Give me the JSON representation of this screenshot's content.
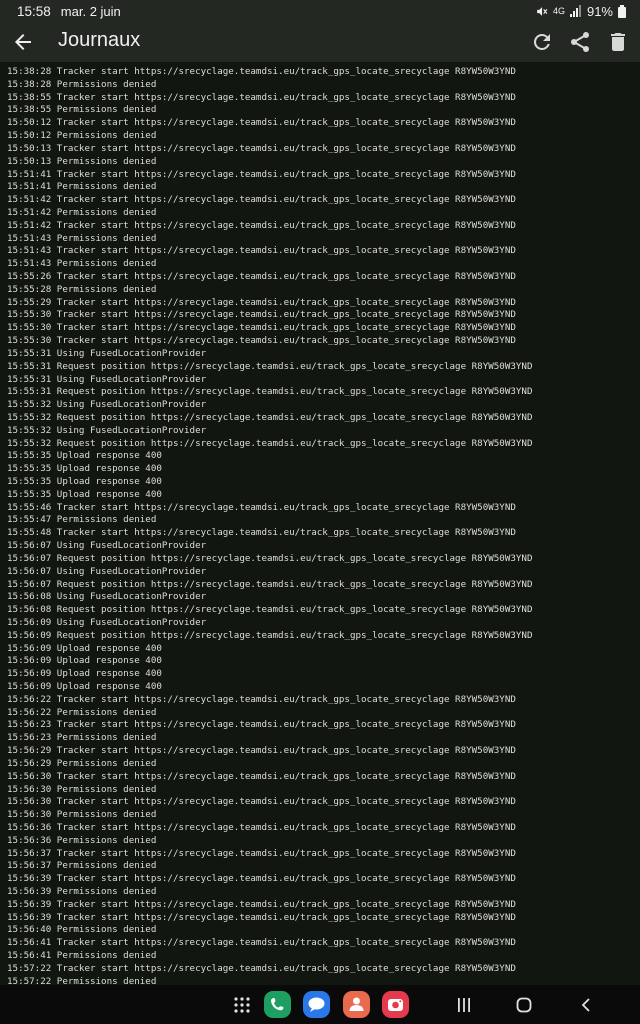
{
  "status_bar": {
    "time": "15:58",
    "date": "mar. 2 juin",
    "network": "4G",
    "battery": "91%"
  },
  "app_bar": {
    "title": "Journaux"
  },
  "log_lines": [
    "15:38:28 Tracker start https://srecyclage.teamdsi.eu/track_gps_locate_srecyclage R8YW50W3YND",
    "15:38:28 Permissions denied",
    "15:38:55 Tracker start https://srecyclage.teamdsi.eu/track_gps_locate_srecyclage R8YW50W3YND",
    "15:38:55 Permissions denied",
    "15:50:12 Tracker start https://srecyclage.teamdsi.eu/track_gps_locate_srecyclage R8YW50W3YND",
    "15:50:12 Permissions denied",
    "15:50:13 Tracker start https://srecyclage.teamdsi.eu/track_gps_locate_srecyclage R8YW50W3YND",
    "15:50:13 Permissions denied",
    "15:51:41 Tracker start https://srecyclage.teamdsi.eu/track_gps_locate_srecyclage R8YW50W3YND",
    "15:51:41 Permissions denied",
    "15:51:42 Tracker start https://srecyclage.teamdsi.eu/track_gps_locate_srecyclage R8YW50W3YND",
    "15:51:42 Permissions denied",
    "15:51:42 Tracker start https://srecyclage.teamdsi.eu/track_gps_locate_srecyclage R8YW50W3YND",
    "15:51:43 Permissions denied",
    "15:51:43 Tracker start https://srecyclage.teamdsi.eu/track_gps_locate_srecyclage R8YW50W3YND",
    "15:51:43 Permissions denied",
    "15:55:26 Tracker start https://srecyclage.teamdsi.eu/track_gps_locate_srecyclage R8YW50W3YND",
    "15:55:28 Permissions denied",
    "15:55:29 Tracker start https://srecyclage.teamdsi.eu/track_gps_locate_srecyclage R8YW50W3YND",
    "15:55:30 Tracker start https://srecyclage.teamdsi.eu/track_gps_locate_srecyclage R8YW50W3YND",
    "15:55:30 Tracker start https://srecyclage.teamdsi.eu/track_gps_locate_srecyclage R8YW50W3YND",
    "15:55:30 Tracker start https://srecyclage.teamdsi.eu/track_gps_locate_srecyclage R8YW50W3YND",
    "15:55:31 Using FusedLocationProvider",
    "15:55:31 Request position https://srecyclage.teamdsi.eu/track_gps_locate_srecyclage R8YW50W3YND",
    "15:55:31 Using FusedLocationProvider",
    "15:55:31 Request position https://srecyclage.teamdsi.eu/track_gps_locate_srecyclage R8YW50W3YND",
    "15:55:32 Using FusedLocationProvider",
    "15:55:32 Request position https://srecyclage.teamdsi.eu/track_gps_locate_srecyclage R8YW50W3YND",
    "15:55:32 Using FusedLocationProvider",
    "15:55:32 Request position https://srecyclage.teamdsi.eu/track_gps_locate_srecyclage R8YW50W3YND",
    "15:55:35 Upload response 400",
    "15:55:35 Upload response 400",
    "15:55:35 Upload response 400",
    "15:55:35 Upload response 400",
    "15:55:46 Tracker start https://srecyclage.teamdsi.eu/track_gps_locate_srecyclage R8YW50W3YND",
    "15:55:47 Permissions denied",
    "15:55:48 Tracker start https://srecyclage.teamdsi.eu/track_gps_locate_srecyclage R8YW50W3YND",
    "15:56:07 Using FusedLocationProvider",
    "15:56:07 Request position https://srecyclage.teamdsi.eu/track_gps_locate_srecyclage R8YW50W3YND",
    "15:56:07 Using FusedLocationProvider",
    "15:56:07 Request position https://srecyclage.teamdsi.eu/track_gps_locate_srecyclage R8YW50W3YND",
    "15:56:08 Using FusedLocationProvider",
    "15:56:08 Request position https://srecyclage.teamdsi.eu/track_gps_locate_srecyclage R8YW50W3YND",
    "15:56:09 Using FusedLocationProvider",
    "15:56:09 Request position https://srecyclage.teamdsi.eu/track_gps_locate_srecyclage R8YW50W3YND",
    "15:56:09 Upload response 400",
    "15:56:09 Upload response 400",
    "15:56:09 Upload response 400",
    "15:56:09 Upload response 400",
    "15:56:22 Tracker start https://srecyclage.teamdsi.eu/track_gps_locate_srecyclage R8YW50W3YND",
    "15:56:22 Permissions denied",
    "15:56:23 Tracker start https://srecyclage.teamdsi.eu/track_gps_locate_srecyclage R8YW50W3YND",
    "15:56:23 Permissions denied",
    "15:56:29 Tracker start https://srecyclage.teamdsi.eu/track_gps_locate_srecyclage R8YW50W3YND",
    "15:56:29 Permissions denied",
    "15:56:30 Tracker start https://srecyclage.teamdsi.eu/track_gps_locate_srecyclage R8YW50W3YND",
    "15:56:30 Permissions denied",
    "15:56:30 Tracker start https://srecyclage.teamdsi.eu/track_gps_locate_srecyclage R8YW50W3YND",
    "15:56:30 Permissions denied",
    "15:56:36 Tracker start https://srecyclage.teamdsi.eu/track_gps_locate_srecyclage R8YW50W3YND",
    "15:56:36 Permissions denied",
    "15:56:37 Tracker start https://srecyclage.teamdsi.eu/track_gps_locate_srecyclage R8YW50W3YND",
    "15:56:37 Permissions denied",
    "15:56:39 Tracker start https://srecyclage.teamdsi.eu/track_gps_locate_srecyclage R8YW50W3YND",
    "15:56:39 Permissions denied",
    "15:56:39 Tracker start https://srecyclage.teamdsi.eu/track_gps_locate_srecyclage R8YW50W3YND",
    "15:56:39 Tracker start https://srecyclage.teamdsi.eu/track_gps_locate_srecyclage R8YW50W3YND",
    "15:56:40 Permissions denied",
    "15:56:41 Tracker start https://srecyclage.teamdsi.eu/track_gps_locate_srecyclage R8YW50W3YND",
    "15:56:41 Permissions denied",
    "15:57:22 Tracker start https://srecyclage.teamdsi.eu/track_gps_locate_srecyclage R8YW50W3YND",
    "15:57:22 Permissions denied"
  ],
  "icons": {
    "back": "back-arrow-icon",
    "refresh": "refresh-icon",
    "share": "share-icon",
    "delete": "trash-icon",
    "nav_apps": "app-drawer-icon",
    "nav_phone": "phone-icon",
    "nav_messages": "messages-icon",
    "nav_contacts": "contacts-icon",
    "nav_camera": "camera-icon",
    "nav_recents": "recents-icon",
    "nav_home": "home-icon",
    "nav_back": "back-chevron-icon"
  },
  "colors": {
    "app_bar_bg": "#232823",
    "log_bg": "#121611",
    "log_text": "#dcdfd8",
    "phone_app": "#1e9e63",
    "messages_app": "#2a78e8",
    "contacts_app": "#ea6a4e",
    "camera_app": "#e5394d"
  }
}
